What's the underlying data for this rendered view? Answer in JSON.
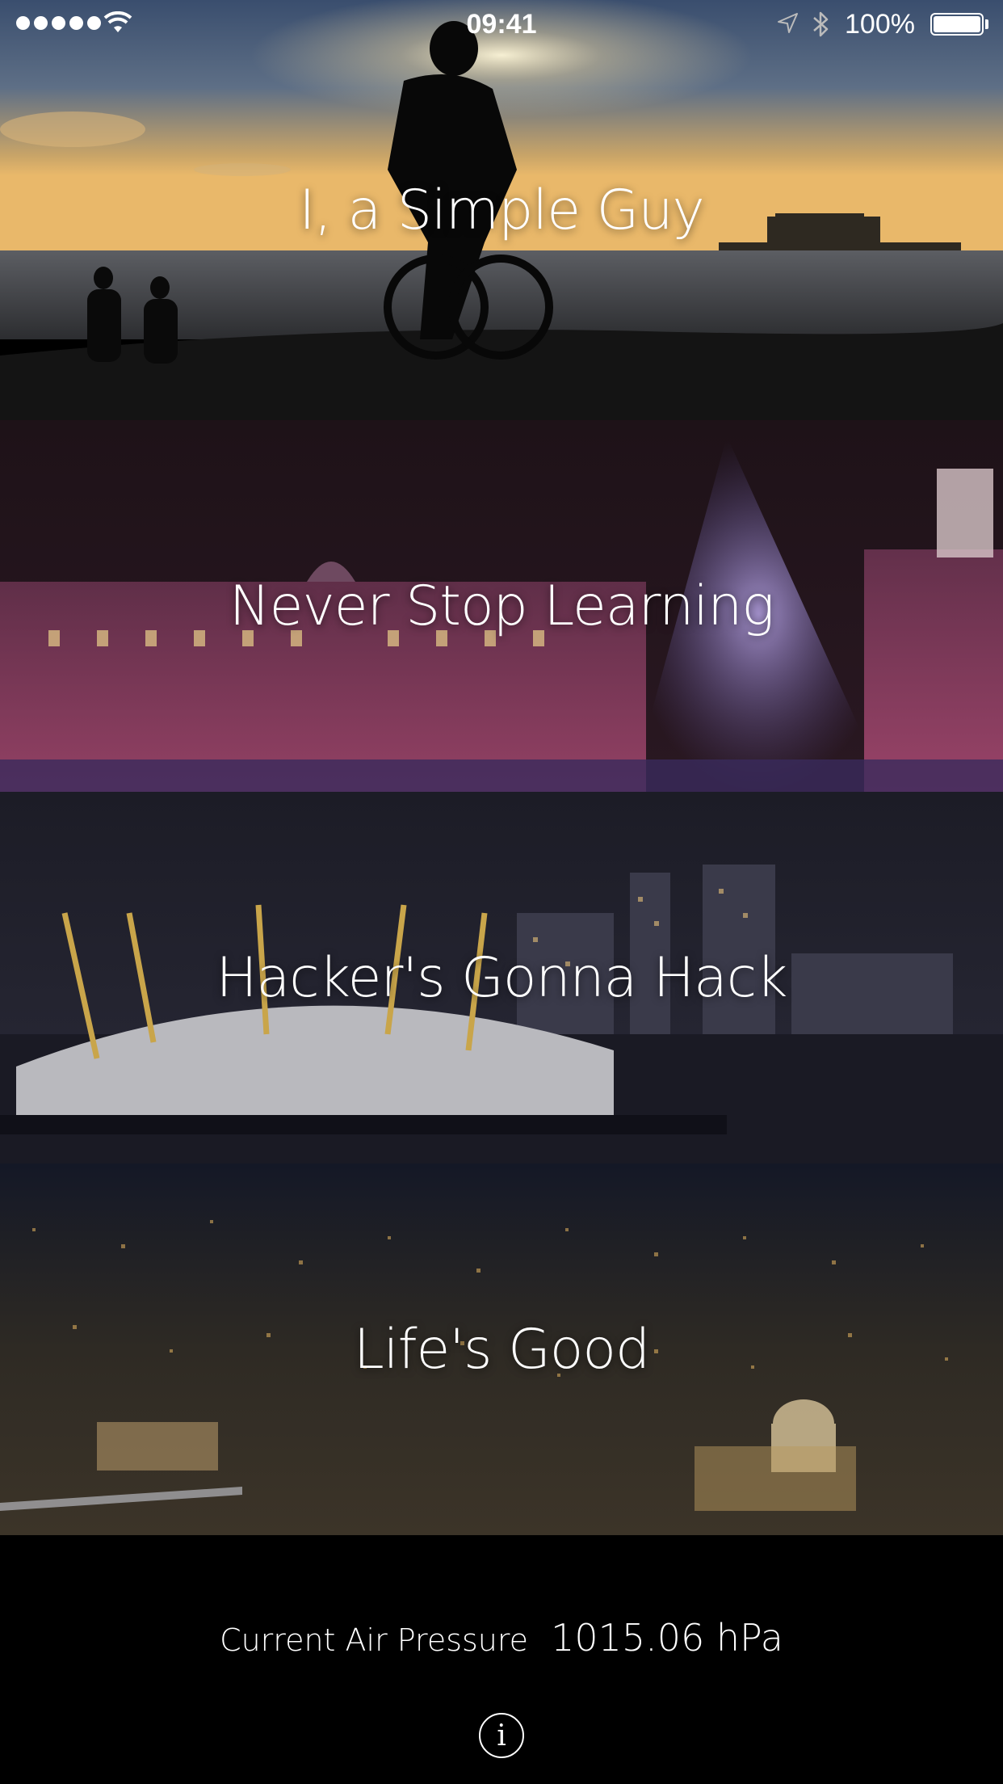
{
  "status_bar": {
    "time": "09:41",
    "battery_percent": "100%",
    "signal_strength": 5,
    "icons": [
      "signal-dots-icon",
      "wifi-icon",
      "location-arrow-icon",
      "bluetooth-icon",
      "battery-icon"
    ]
  },
  "cards": [
    {
      "title": "I, a Simple Guy",
      "image": "sunset-beach-cyclist"
    },
    {
      "title": "Never Stop Learning",
      "image": "lit-palace-christmas-tree"
    },
    {
      "title": "Hacker's Gonna Hack",
      "image": "dome-city-night"
    },
    {
      "title": "Life's Good",
      "image": "city-lights-aerial"
    }
  ],
  "footer": {
    "pressure_label": "Current Air Pressure",
    "pressure_value": "1015.06 hPa",
    "info_icon": "info-icon"
  }
}
